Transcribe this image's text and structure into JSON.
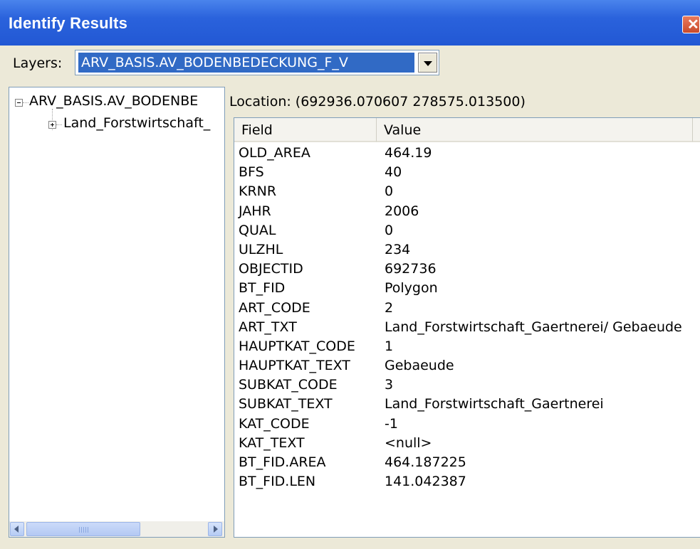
{
  "window": {
    "title": "Identify Results",
    "close_symbol": "✕"
  },
  "layers": {
    "label": "Layers:",
    "selected": "ARV_BASIS.AV_BODENBEDECKUNG_F_V"
  },
  "tree": {
    "root_label": "ARV_BASIS.AV_BODENBE",
    "child_label": "Land_Forstwirtschaft_"
  },
  "location": {
    "text": "Location: (692936.070607 278575.013500)"
  },
  "table": {
    "headers": [
      "Field",
      "Value"
    ],
    "rows": [
      {
        "field": "OLD_AREA",
        "value": "464.19"
      },
      {
        "field": "BFS",
        "value": "40"
      },
      {
        "field": "KRNR",
        "value": "0"
      },
      {
        "field": "JAHR",
        "value": "2006"
      },
      {
        "field": "QUAL",
        "value": "0"
      },
      {
        "field": "ULZHL",
        "value": "234"
      },
      {
        "field": "OBJECTID",
        "value": "692736"
      },
      {
        "field": "BT_FID",
        "value": "Polygon"
      },
      {
        "field": "ART_CODE",
        "value": "2"
      },
      {
        "field": "ART_TXT",
        "value": "Land_Forstwirtschaft_Gaertnerei/ Gebaeude"
      },
      {
        "field": "HAUPTKAT_CODE",
        "value": "1"
      },
      {
        "field": "HAUPTKAT_TEXT",
        "value": "Gebaeude"
      },
      {
        "field": "SUBKAT_CODE",
        "value": "3"
      },
      {
        "field": "SUBKAT_TEXT",
        "value": "Land_Forstwirtschaft_Gaertnerei"
      },
      {
        "field": "KAT_CODE",
        "value": "-1"
      },
      {
        "field": "KAT_TEXT",
        "value": "<null>"
      },
      {
        "field": "BT_FID.AREA",
        "value": "464.187225"
      },
      {
        "field": "BT_FID.LEN",
        "value": "141.042387"
      }
    ]
  },
  "colors": {
    "titlebar": "#2a62dc",
    "selection": "#316ac5",
    "window_bg": "#ece9d8"
  }
}
